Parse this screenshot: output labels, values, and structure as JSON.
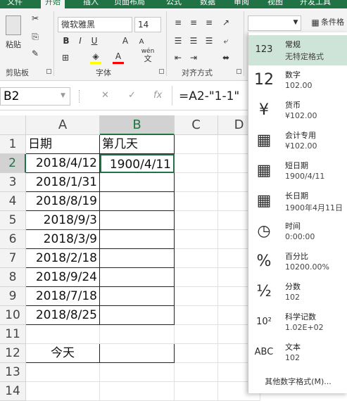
{
  "ribbon": {
    "tabs": [
      "文件",
      "开始",
      "插入",
      "页面布局",
      "公式",
      "数据",
      "审阅",
      "视图",
      "开发工具"
    ],
    "active_tab": "开始",
    "paste_label": "粘贴",
    "clipboard_label": "剪贴板",
    "font_name": "微软雅黑",
    "font_size": "14",
    "font_group_label": "字体",
    "bold": "B",
    "italic": "I",
    "underline": "U",
    "font_grow": "A",
    "font_shrink": "A",
    "fill_color": "#ffff00",
    "font_color_letter": "A",
    "font_color": "#ff0000",
    "wen_label": "wén",
    "wen_char": "文",
    "alignment_label": "对齐方式",
    "conditional_format_label": "条件格"
  },
  "formula_bar": {
    "name_box": "B2",
    "fx": "fx",
    "cancel": "✕",
    "enter": "✓",
    "formula": "=A2-\"1-1\""
  },
  "sheet": {
    "columns": [
      "A",
      "B",
      "C",
      "D"
    ],
    "rows": [
      "1",
      "2",
      "3",
      "4",
      "5",
      "6",
      "7",
      "8",
      "9",
      "10",
      "11",
      "12",
      "13",
      "14"
    ],
    "a1": "日期",
    "b1": "第几天",
    "dates": [
      "2018/4/12",
      "2018/1/31",
      "2018/8/19",
      "2018/9/3",
      "2018/3/9",
      "2018/2/18",
      "2018/9/24",
      "2018/7/18",
      "2018/8/25"
    ],
    "b2": "1900/4/11",
    "a12": "今天"
  },
  "number_format_menu": {
    "items": [
      {
        "name": "常规",
        "sample": "无特定格式",
        "icon": "clock-123-icon",
        "glyph": "123"
      },
      {
        "name": "数字",
        "sample": "102.00",
        "icon": "number-12-icon",
        "glyph": "12"
      },
      {
        "name": "货币",
        "sample": "¥102.00",
        "icon": "currency-icon",
        "glyph": "¥"
      },
      {
        "name": "会计专用",
        "sample": "¥102.00",
        "icon": "accounting-icon",
        "glyph": "▦"
      },
      {
        "name": "短日期",
        "sample": "1900/4/11",
        "icon": "calendar-icon",
        "glyph": "▦"
      },
      {
        "name": "长日期",
        "sample": "1900年4月11日",
        "icon": "calendar-icon",
        "glyph": "▦"
      },
      {
        "name": "时间",
        "sample": "0:00:00",
        "icon": "clock-icon",
        "glyph": "◷"
      },
      {
        "name": "百分比",
        "sample": "10200.00%",
        "icon": "percent-icon",
        "glyph": "%"
      },
      {
        "name": "分数",
        "sample": "102",
        "icon": "fraction-icon",
        "glyph": "½"
      },
      {
        "name": "科学记数",
        "sample": "1.02E+02",
        "icon": "scientific-icon",
        "glyph": "10²"
      },
      {
        "name": "文本",
        "sample": "102",
        "icon": "text-abc-icon",
        "glyph": "ABC"
      }
    ],
    "more_formats": "其他数字格式(M)..."
  }
}
